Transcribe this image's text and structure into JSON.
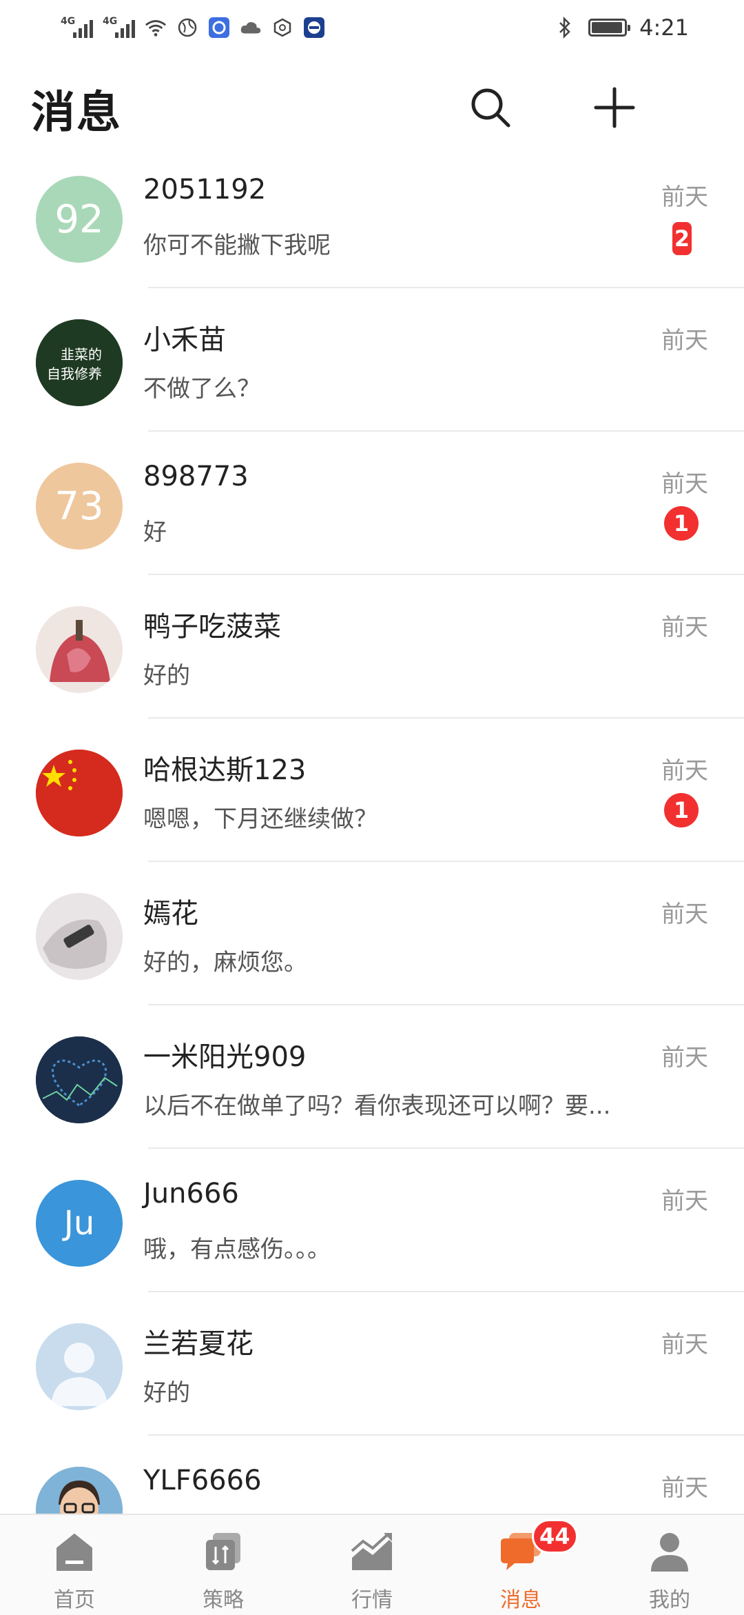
{
  "status_bar": {
    "time": "4:21",
    "network_labels": [
      "4G",
      "4G"
    ],
    "icons": [
      "signal-icon",
      "signal-icon",
      "wifi-icon",
      "globe-icon",
      "app-icon",
      "cloud-icon",
      "hexagon-icon",
      "app-icon",
      "bluetooth-icon",
      "battery-icon"
    ]
  },
  "header": {
    "title": "消息",
    "search_icon": "search-icon",
    "add_icon": "plus-icon"
  },
  "conversations": [
    {
      "name": "2051192",
      "preview": "你可不能撇下我呢",
      "time": "前天",
      "badge": "2",
      "avatar_text": "92",
      "avatar_color": "#a9d8b8"
    },
    {
      "name": "小禾苗",
      "preview": "不做了么？",
      "time": "前天",
      "badge": "",
      "avatar_text": "韭菜的 自我修养",
      "avatar_color": "#1f3a22"
    },
    {
      "name": "898773",
      "preview": "好",
      "time": "前天",
      "badge": "1",
      "avatar_text": "73",
      "avatar_color": "#efc79d"
    },
    {
      "name": "鸭子吃菠菜",
      "preview": "好的",
      "time": "前天",
      "badge": "",
      "avatar_text": "",
      "avatar_color": "#c94a55"
    },
    {
      "name": "哈根达斯123",
      "preview": "嗯嗯，下月还继续做？",
      "time": "前天",
      "badge": "1",
      "avatar_text": "",
      "avatar_color": "#d52b1e"
    },
    {
      "name": "嫣花",
      "preview": "好的，麻烦您。",
      "time": "前天",
      "badge": "",
      "avatar_text": "",
      "avatar_color": "#c9c3c6"
    },
    {
      "name": "一米阳光909",
      "preview": "以后不在做单了吗？看你表现还可以啊？要...",
      "time": "前天",
      "badge": "",
      "avatar_text": "",
      "avatar_color": "#1b2f4a"
    },
    {
      "name": "Jun666",
      "preview": "哦，有点感伤。。。",
      "time": "前天",
      "badge": "",
      "avatar_text": "Ju",
      "avatar_color": "#3a95da"
    },
    {
      "name": "兰若夏花",
      "preview": "好的",
      "time": "前天",
      "badge": "",
      "avatar_text": "",
      "avatar_color": "#bcd4ea"
    },
    {
      "name": "YLF6666",
      "preview": "",
      "time": "前天",
      "badge": "",
      "avatar_text": "",
      "avatar_color": "#7fb3d8"
    }
  ],
  "tabbar": {
    "tabs": [
      {
        "label": "首页",
        "icon": "home-icon"
      },
      {
        "label": "策略",
        "icon": "strategy-icon"
      },
      {
        "label": "行情",
        "icon": "market-chart-icon"
      },
      {
        "label": "消息",
        "icon": "message-icon",
        "badge": "44",
        "active": true
      },
      {
        "label": "我的",
        "icon": "profile-icon"
      }
    ]
  },
  "colors": {
    "accent": "#ef6b2b",
    "badge": "#f23030",
    "text_secondary": "#999999"
  }
}
